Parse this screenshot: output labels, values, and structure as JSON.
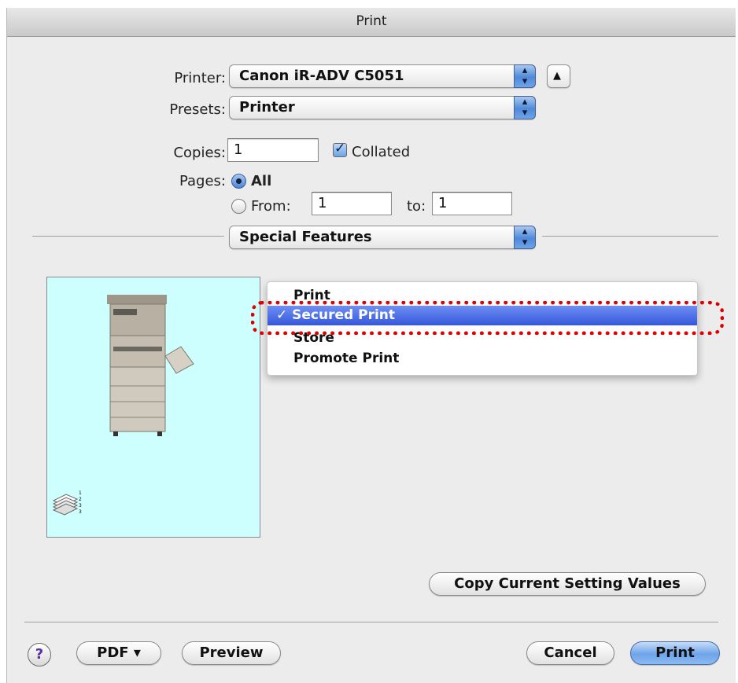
{
  "window": {
    "title": "Print"
  },
  "printer": {
    "label": "Printer:",
    "value": "Canon iR-ADV C5051"
  },
  "presets": {
    "label": "Presets:",
    "value": "Printer"
  },
  "copies": {
    "label": "Copies:",
    "value": "1",
    "collated_label": "Collated",
    "collated_checked": true
  },
  "pages": {
    "label": "Pages:",
    "all_label": "All",
    "from_label": "From:",
    "from_value": "1",
    "to_label": "to:",
    "to_value": "1",
    "selected": "All"
  },
  "panel_select": {
    "value": "Special Features"
  },
  "menu": {
    "items": [
      {
        "label": "Print"
      },
      {
        "label": "Secured Print",
        "selected": true,
        "mark": "✓"
      },
      {
        "label": "Store"
      },
      {
        "label": "Promote Print"
      }
    ],
    "selected_display": "✓ Secured Print",
    "highlight_color": "#e00000"
  },
  "buttons": {
    "copy_values": "Copy Current Setting Values",
    "help": "?",
    "pdf": "PDF ▾",
    "preview": "Preview",
    "cancel": "Cancel",
    "print": "Print"
  },
  "icons": {
    "printer_up": "triangle-up-icon",
    "popup_arrows": "up-down-arrows-icon",
    "device": "copier-machine-icon",
    "collation": "paper-stack-icon"
  }
}
